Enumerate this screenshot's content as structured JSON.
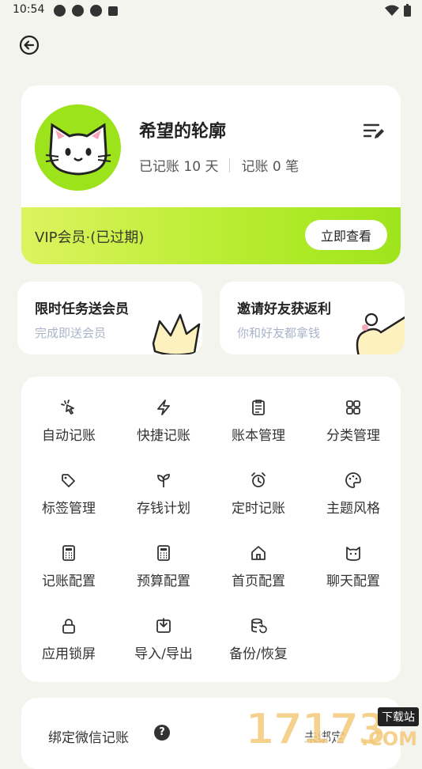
{
  "status_bar": {
    "time": "10:54"
  },
  "profile": {
    "name": "希望的轮廓",
    "stat_days": "已记账 10 天",
    "stat_count": "记账 0 笔",
    "vip_text": "VIP会员·(已过期)",
    "vip_button": "立即查看"
  },
  "promos": [
    {
      "title": "限时任务送会员",
      "subtitle": "完成即送会员"
    },
    {
      "title": "邀请好友获返利",
      "subtitle": "你和好友都拿钱"
    }
  ],
  "grid": [
    {
      "label": "自动记账",
      "icon": "cursor-click-icon"
    },
    {
      "label": "快捷记账",
      "icon": "lightning-icon"
    },
    {
      "label": "账本管理",
      "icon": "clipboard-icon"
    },
    {
      "label": "分类管理",
      "icon": "grid-icon"
    },
    {
      "label": "标签管理",
      "icon": "tags-icon"
    },
    {
      "label": "存钱计划",
      "icon": "sprout-icon"
    },
    {
      "label": "定时记账",
      "icon": "alarm-icon"
    },
    {
      "label": "主题风格",
      "icon": "palette-icon"
    },
    {
      "label": "记账配置",
      "icon": "calculator-icon"
    },
    {
      "label": "预算配置",
      "icon": "calculator-icon"
    },
    {
      "label": "首页配置",
      "icon": "home-icon"
    },
    {
      "label": "聊天配置",
      "icon": "cat-icon"
    },
    {
      "label": "应用锁屏",
      "icon": "lock-icon"
    },
    {
      "label": "导入/导出",
      "icon": "import-export-icon"
    },
    {
      "label": "备份/恢复",
      "icon": "backup-icon"
    }
  ],
  "bind": {
    "label": "绑定微信记账",
    "status": "未绑定"
  },
  "watermark": {
    "digits": "17173",
    "tag": "下载站",
    "suffix": ".COM"
  },
  "colors": {
    "accent": "#9ce31c",
    "background": "#f4f4ee"
  }
}
